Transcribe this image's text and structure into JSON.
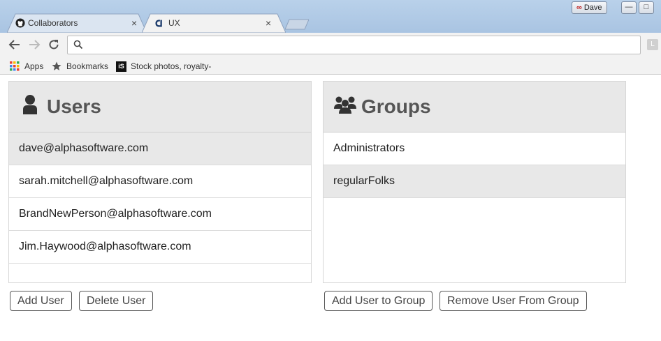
{
  "window": {
    "user_label": "Dave"
  },
  "tabs": [
    {
      "title": "Collaborators",
      "close": "×"
    },
    {
      "title": "UX",
      "close": "×"
    }
  ],
  "toolbar": {
    "address_value": "",
    "extension_label": "L"
  },
  "bookmarks": [
    {
      "label": "Apps",
      "icon": "apps-grid-icon"
    },
    {
      "label": "Bookmarks",
      "icon": "star-icon"
    },
    {
      "label": "Stock photos, royalty-",
      "icon": "istock-icon",
      "icon_text": "iS"
    }
  ],
  "users_panel": {
    "title": "Users",
    "items": [
      {
        "label": "dave@alphasoftware.com"
      },
      {
        "label": "sarah.mitchell@alphasoftware.com"
      },
      {
        "label": "BrandNewPerson@alphasoftware.com"
      },
      {
        "label": "Jim.Haywood@alphasoftware.com"
      }
    ],
    "selected_index": 0
  },
  "groups_panel": {
    "title": "Groups",
    "items": [
      {
        "label": "Administrators"
      },
      {
        "label": "regularFolks"
      }
    ],
    "selected_index": 1
  },
  "buttons": {
    "add_user": "Add User",
    "delete_user": "Delete User",
    "add_user_to_group": "Add User to Group",
    "remove_user_from_group": "Remove User From Group"
  },
  "colors": {
    "selected_row": "#e8e8e8",
    "header_bg": "#e8e8e8",
    "title_text": "#555555"
  }
}
